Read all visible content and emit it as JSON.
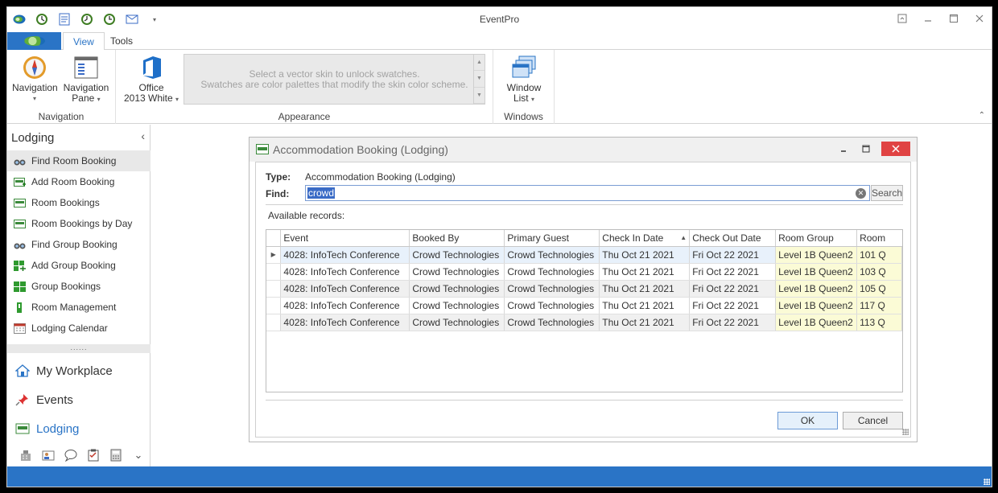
{
  "app": {
    "title": "EventPro"
  },
  "ribbon": {
    "tabs": [
      "View",
      "Tools"
    ],
    "groups": {
      "navigation": {
        "label": "Navigation",
        "navigation_btn": "Navigation",
        "navigation_pane_btn_line1": "Navigation",
        "navigation_pane_btn_line2": "Pane"
      },
      "appearance": {
        "label": "Appearance",
        "skin_line1": "Office",
        "skin_line2": "2013 White",
        "swatch_msg_line1": "Select a vector skin to unlock swatches.",
        "swatch_msg_line2": "Swatches are color palettes that modify the skin color scheme."
      },
      "windows": {
        "label": "Windows",
        "window_list_line1": "Window",
        "window_list_line2": "List"
      }
    }
  },
  "nav_pane": {
    "title": "Lodging",
    "items": [
      {
        "label": "Find Room Booking",
        "icon": "binoculars-icon",
        "selected": true
      },
      {
        "label": "Add Room Booking",
        "icon": "add-booking-icon"
      },
      {
        "label": "Room Bookings",
        "icon": "bookings-icon"
      },
      {
        "label": "Room Bookings by Day",
        "icon": "bookings-day-icon"
      },
      {
        "label": "Find Group Booking",
        "icon": "binoculars-icon"
      },
      {
        "label": "Add Group Booking",
        "icon": "add-group-icon"
      },
      {
        "label": "Group Bookings",
        "icon": "group-bookings-icon"
      },
      {
        "label": "Room Management",
        "icon": "room-management-icon"
      },
      {
        "label": "Lodging Calendar",
        "icon": "calendar-icon"
      }
    ],
    "splitter": "......",
    "modules": [
      {
        "label": "My Workplace",
        "icon": "home-icon"
      },
      {
        "label": "Events",
        "icon": "pushpin-icon"
      },
      {
        "label": "Lodging",
        "icon": "bed-icon",
        "active": true
      }
    ]
  },
  "dialog": {
    "title": "Accommodation Booking (Lodging)",
    "type_label": "Type:",
    "type_value": "Accommodation Booking (Lodging)",
    "find_label": "Find:",
    "find_value": "crowd",
    "search_label": "Search",
    "available_label": "Available records:",
    "columns": [
      "Event",
      "Booked By",
      "Primary Guest",
      "Check In Date",
      "Check Out Date",
      "Room Group",
      "Room"
    ],
    "rows": [
      [
        "4028: InfoTech Conference",
        "Crowd Technologies",
        "Crowd Technologies",
        "Thu Oct 21 2021",
        "Fri Oct 22 2021",
        "Level 1B Queen2",
        "101 Q"
      ],
      [
        "4028: InfoTech Conference",
        "Crowd Technologies",
        "Crowd Technologies",
        "Thu Oct 21 2021",
        "Fri Oct 22 2021",
        "Level 1B Queen2",
        "103 Q"
      ],
      [
        "4028: InfoTech Conference",
        "Crowd Technologies",
        "Crowd Technologies",
        "Thu Oct 21 2021",
        "Fri Oct 22 2021",
        "Level 1B Queen2",
        "105 Q"
      ],
      [
        "4028: InfoTech Conference",
        "Crowd Technologies",
        "Crowd Technologies",
        "Thu Oct 21 2021",
        "Fri Oct 22 2021",
        "Level 1B Queen2",
        "117 Q"
      ],
      [
        "4028: InfoTech Conference",
        "Crowd Technologies",
        "Crowd Technologies",
        "Thu Oct 21 2021",
        "Fri Oct 22 2021",
        "Level 1B Queen2",
        "113 Q"
      ]
    ],
    "ok_label": "OK",
    "cancel_label": "Cancel"
  },
  "colors": {
    "accent": "#2a74c6",
    "highlight_cell": "#fbfbd6",
    "close_button": "#e04343"
  }
}
